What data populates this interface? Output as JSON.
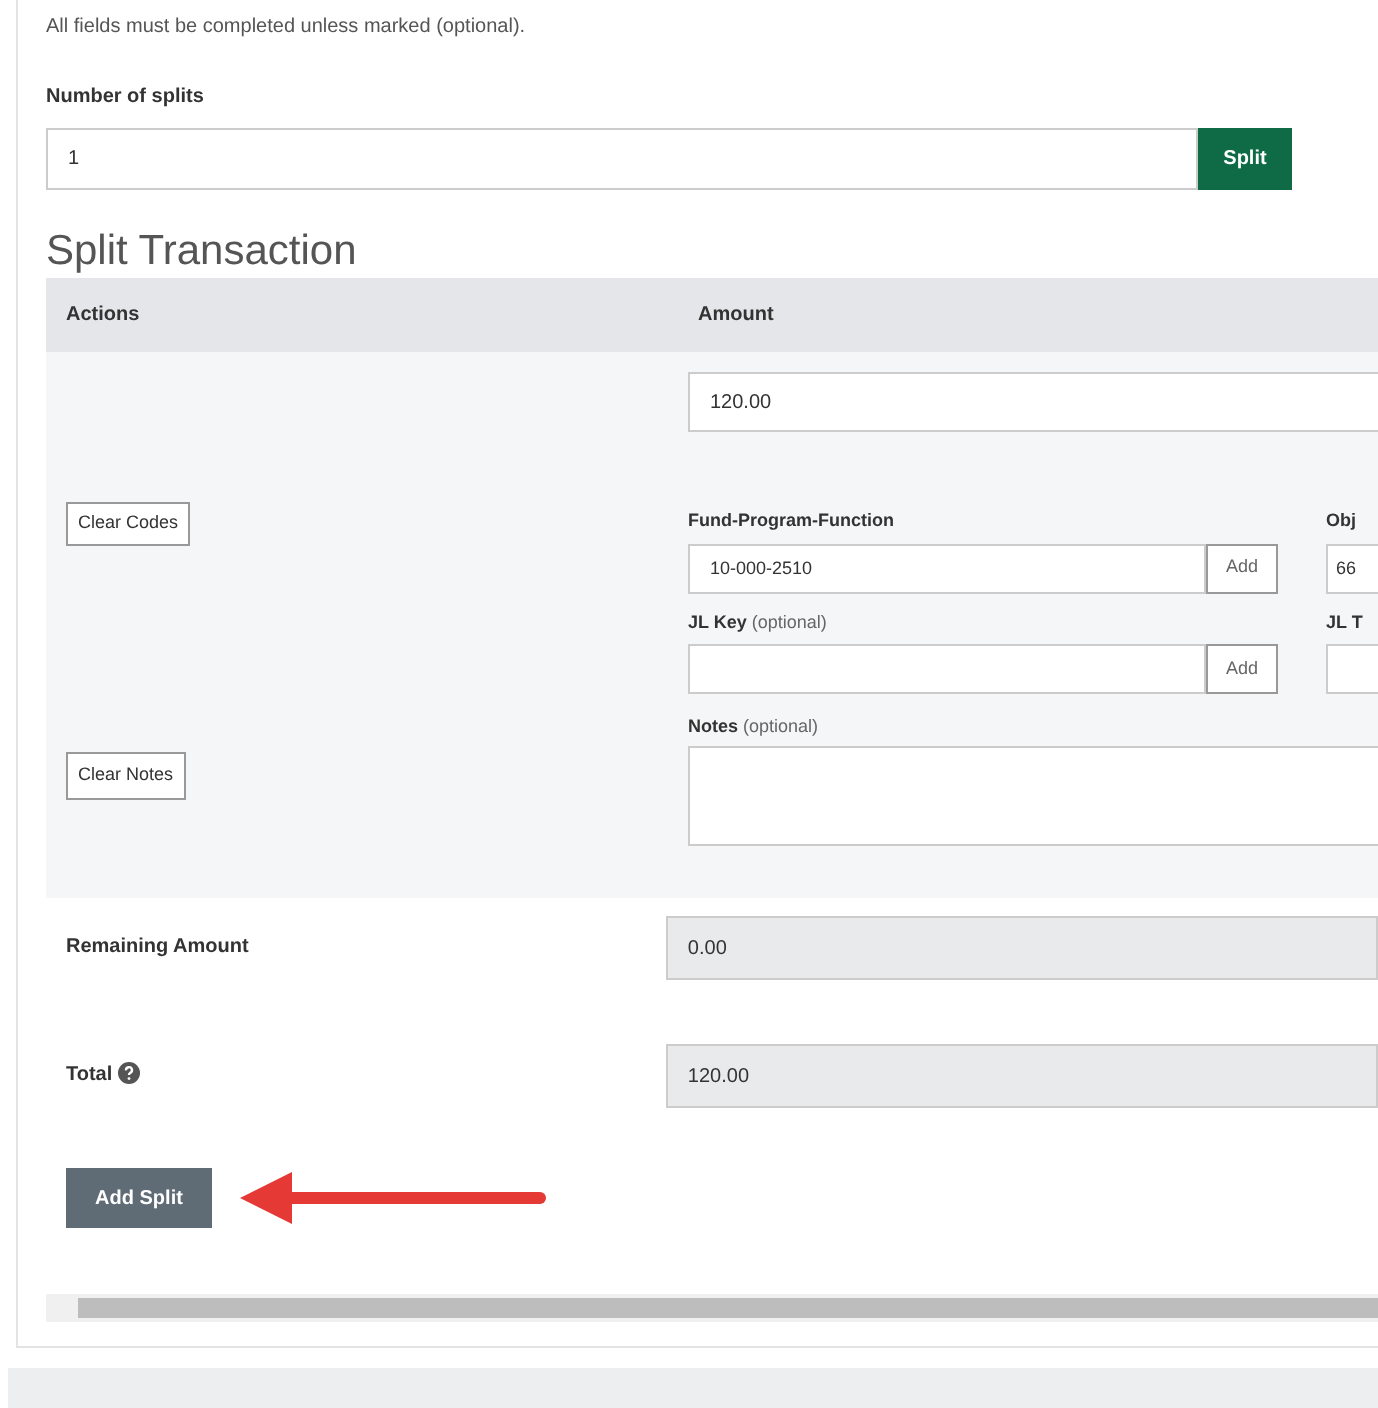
{
  "intro": "All fields must be completed unless marked (optional).",
  "splits": {
    "label": "Number of splits",
    "value": "1",
    "button": "Split"
  },
  "heading": "Split Transaction",
  "table": {
    "columns": [
      "Actions",
      "Amount"
    ],
    "amount": "120.00",
    "actions": [
      "Clear Codes",
      "Clear Notes"
    ],
    "code_fields": [
      {
        "label": "Fund-Program-Function",
        "value": "10-000-2510",
        "button": "Add",
        "side_label": "Obj",
        "side_value": "66"
      },
      {
        "label": "JL Key",
        "optional": "(optional)",
        "button": "Add",
        "side_label": "JL T"
      }
    ],
    "notes": {
      "label": "Notes",
      "optional": "(optional)"
    }
  },
  "remaining": {
    "label": "Remaining Amount",
    "value": "0.00"
  },
  "total": {
    "label": "Total",
    "value": "120.00"
  },
  "add_split": "Add Split"
}
